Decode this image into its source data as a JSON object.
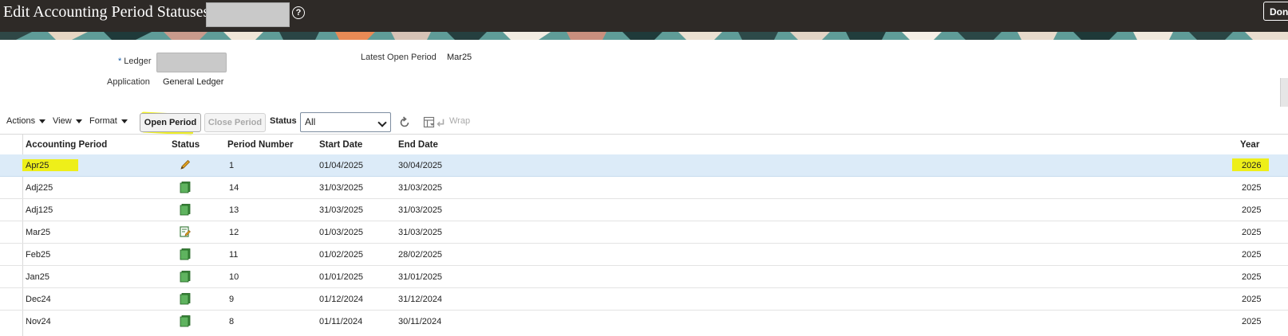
{
  "header": {
    "title": "Edit Accounting Period Statuses:",
    "help_icon": "help-circle-icon",
    "done_label": "Done"
  },
  "colors": {
    "header_bg": "#2e2a27",
    "selected_row": "#dcebf8",
    "highlight": "#f0f000",
    "required_marker": "#1a5fa8"
  },
  "form": {
    "ledger_required_mark": "*",
    "ledger_label": "Ledger",
    "application_label": "Application",
    "application_value": "General Ledger",
    "latest_open_label": "Latest Open Period",
    "latest_open_value": "Mar25"
  },
  "toolbar": {
    "actions": "Actions",
    "view": "View",
    "format": "Format",
    "open_period": "Open Period",
    "close_period": "Close Period",
    "status_label": "Status",
    "status_value": "All",
    "refresh_icon": "refresh-icon",
    "freeze_icon": "freeze-columns-icon",
    "wrap_icon": "wrap-icon",
    "wrap": "Wrap"
  },
  "table": {
    "columns": [
      "Accounting Period",
      "Status",
      "Period Number",
      "Start Date",
      "End Date",
      "Year"
    ],
    "rows": [
      {
        "period": "Apr25",
        "status_icon": "pencil-icon",
        "number": "1",
        "start": "01/04/2025",
        "end": "30/04/2025",
        "year": "2026"
      },
      {
        "period": "Adj225",
        "status_icon": "ledger-book-icon",
        "number": "14",
        "start": "31/03/2025",
        "end": "31/03/2025",
        "year": "2025"
      },
      {
        "period": "Adj125",
        "status_icon": "ledger-book-icon",
        "number": "13",
        "start": "31/03/2025",
        "end": "31/03/2025",
        "year": "2025"
      },
      {
        "period": "Mar25",
        "status_icon": "edit-document-icon",
        "number": "12",
        "start": "01/03/2025",
        "end": "31/03/2025",
        "year": "2025"
      },
      {
        "period": "Feb25",
        "status_icon": "ledger-book-icon",
        "number": "11",
        "start": "01/02/2025",
        "end": "28/02/2025",
        "year": "2025"
      },
      {
        "period": "Jan25",
        "status_icon": "ledger-book-icon",
        "number": "10",
        "start": "01/01/2025",
        "end": "31/01/2025",
        "year": "2025"
      },
      {
        "period": "Dec24",
        "status_icon": "ledger-book-icon",
        "number": "9",
        "start": "01/12/2024",
        "end": "31/12/2024",
        "year": "2025"
      },
      {
        "period": "Nov24",
        "status_icon": "ledger-book-icon",
        "number": "8",
        "start": "01/11/2024",
        "end": "30/11/2024",
        "year": "2025"
      }
    ]
  }
}
